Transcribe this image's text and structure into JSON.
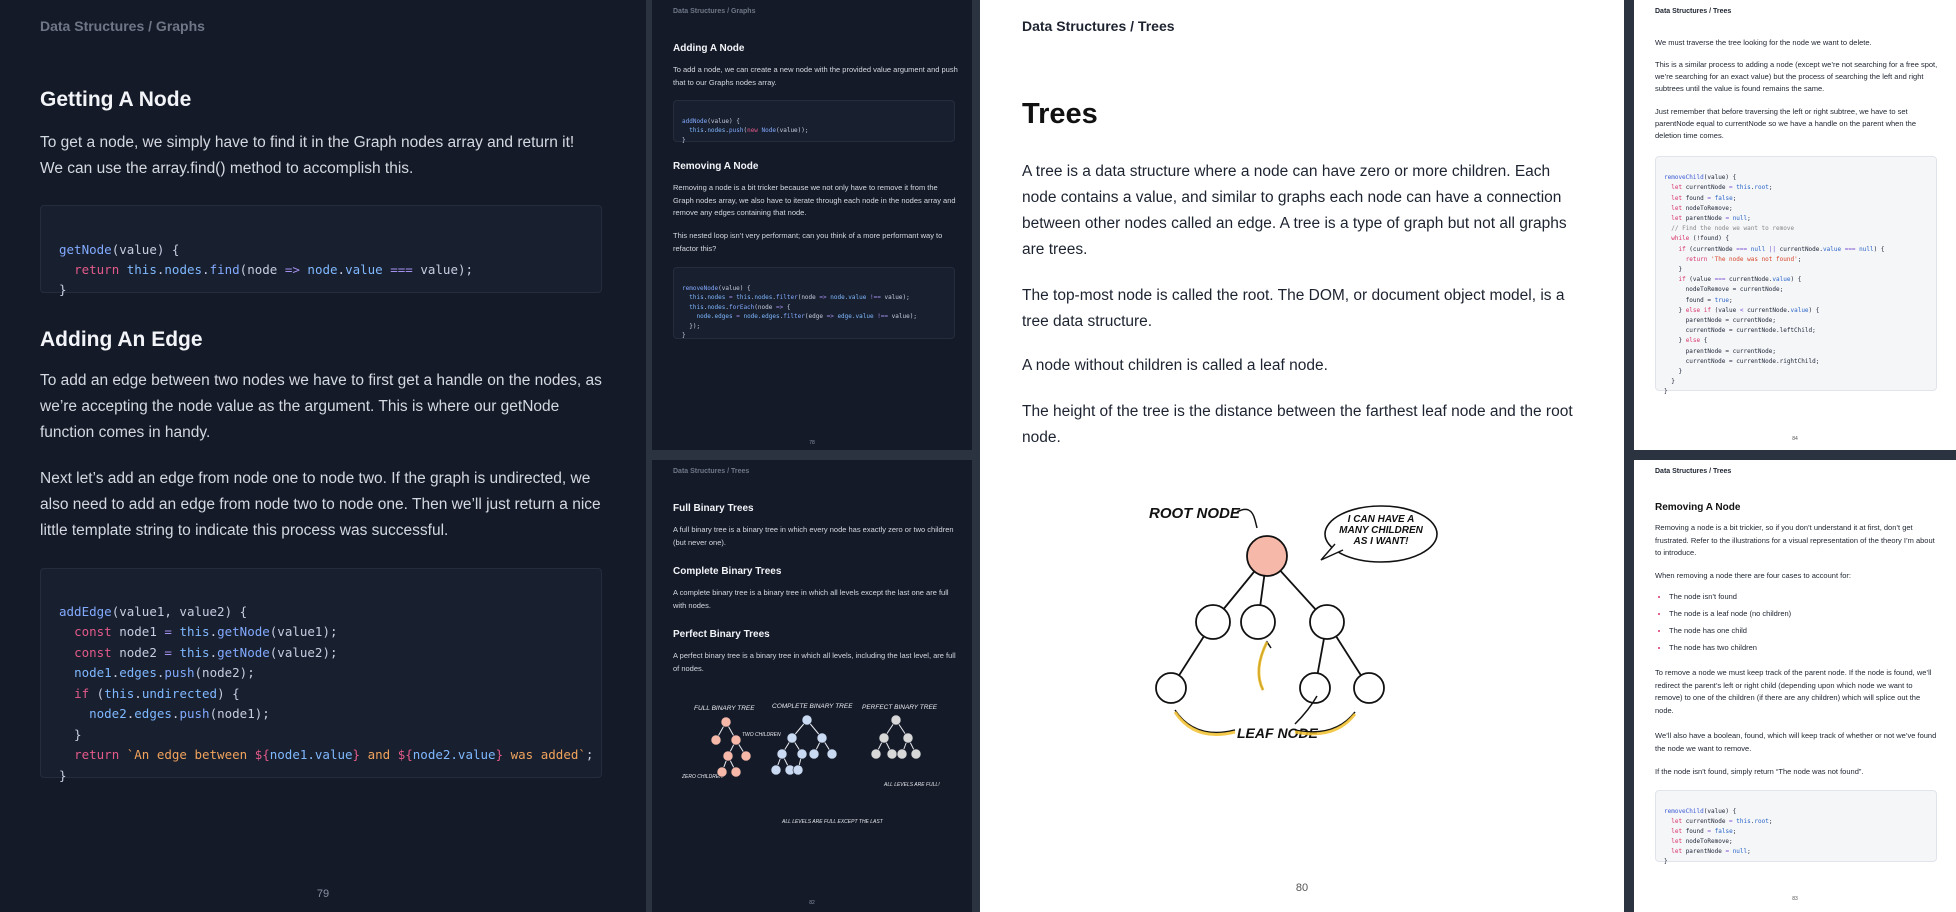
{
  "p79": {
    "crumb": "Data Structures / Graphs",
    "h_getnode": "Getting A Node",
    "para1": "To get a node, we simply have to find it in the Graph nodes array and return it! We can use the array.find() method to accomplish this.",
    "h_addedge": "Adding An Edge",
    "para2": "To add an edge between two nodes we have to first get a handle on the nodes, as we’re accepting the node value as the argument. This is where our getNode function comes in handy.",
    "para3": "Next let’s add an edge from node one to node two. If the graph is undirected, we also need to add an edge from node two to node one. Then we’ll just return a nice little template string to indicate this process was successful.",
    "page_num": "79"
  },
  "p78": {
    "crumb": "Data Structures / Graphs",
    "h_addnode": "Adding A Node",
    "para1": "To add a node, we can create a new node with the provided value argument and push that to our Graphs nodes array.",
    "h_removenode": "Removing A Node",
    "para2": "Removing a node is a bit tricker because we not only have to remove it from the Graph nodes array, we also have to iterate through each node in the nodes array and remove any edges containing that node.",
    "para3": "This nested loop isn’t very performant; can you think of a more performant way to refactor this?",
    "page_num": "78"
  },
  "p82": {
    "crumb": "Data Structures / Trees",
    "h_full": "Full Binary Trees",
    "para_full": "A full binary tree is a binary tree in which every node has exactly zero or two children (but never one).",
    "h_complete": "Complete Binary Trees",
    "para_complete": "A complete binary tree is a binary tree in which all levels except the last one are full with nodes.",
    "h_perfect": "Perfect Binary Trees",
    "para_perfect": "A perfect binary tree is a binary tree in which all levels, including the last level, are full of nodes.",
    "ill_full": "FULL BINARY TREE",
    "ill_complete": "COMPLETE BINARY TREE",
    "ill_perfect": "PERFECT BINARY TREE",
    "ill_two": "TWO CHILDREN",
    "ill_zero": "ZERO CHILDREN",
    "ill_alllast": "ALL LEVELS ARE FULL EXCEPT THE LAST",
    "ill_allfull": "ALL LEVELS ARE FULL!",
    "page_num": "82"
  },
  "p80": {
    "crumb": "Data Structures / Trees",
    "title": "Trees",
    "para1": "A tree is a data structure where a node can have zero or more children. Each node contains a value, and similar to graphs each node can have a connection between other nodes called an edge. A tree is a type of graph but not all graphs are trees.",
    "para2": "The top-most node is called the root. The DOM, or document object model, is a tree data structure.",
    "para3": "A node without children is called a leaf node.",
    "para4": "The height of the tree is the distance between the farthest leaf node and the root node.",
    "ill_root": "ROOT NODE",
    "ill_bubble": "I CAN HAVE A MANY CHILDREN AS I WANT!",
    "ill_leaf": "LEAF NODE",
    "page_num": "80"
  },
  "p84": {
    "crumb": "Data Structures / Trees",
    "para1": "We must traverse the tree looking for the node we want to delete.",
    "para2": "This is a similar process to adding a node (except we’re not searching for a free spot, we’re searching for an exact value) but the process of searching the left and right subtrees until the value is found remains the same.",
    "para3": "Just remember that before traversing the left or right subtree, we have to set parentNode equal to currentNode so we have a handle on the parent when the deletion time comes.",
    "page_num": "84"
  },
  "p83": {
    "crumb": "Data Structures / Trees",
    "h_remove": "Removing A Node",
    "para1": "Removing a node is a bit trickier, so if you don’t understand it at first, don’t get frustrated. Refer to the illustrations for a visual representation of the theory I’m about to introduce.",
    "para2": "When removing a node there are four cases to account for:",
    "cases": [
      "The node isn’t found",
      "The node is a leaf node (no children)",
      "The node has one child",
      "The node has two children"
    ],
    "para3": "To remove a node we must keep track of the parent node. If the node is found, we’ll redirect the parent’s left or right child (depending upon which node we want to remove) to one of the children (if there are any children) which will splice out the node.",
    "para4": "We’ll also have a boolean, found, which will keep track of whether or not we’ve found the node we want to remove.",
    "para5": "If the node isn’t found, simply return “The node was not found”.",
    "page_num": "83"
  }
}
